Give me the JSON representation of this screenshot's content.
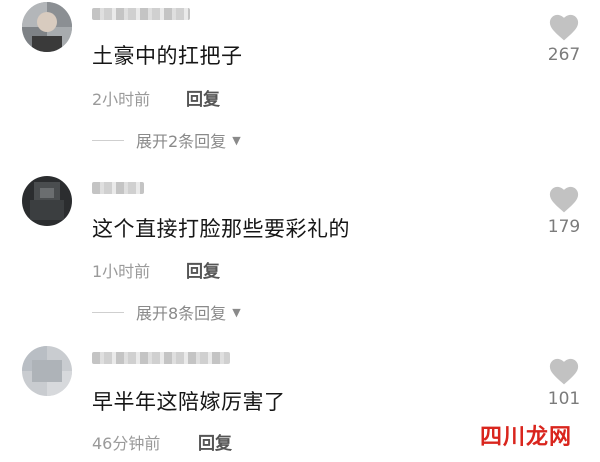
{
  "comments": [
    {
      "content": "土豪中的扛把子",
      "time": "2小时前",
      "reply_label": "回复",
      "likes": "267",
      "expand_label": "展开2条回复"
    },
    {
      "content": "这个直接打脸那些要彩礼的",
      "time": "1小时前",
      "reply_label": "回复",
      "likes": "179",
      "expand_label": "展开8条回复"
    },
    {
      "content": "早半年这陪嫁厉害了",
      "time": "46分钟前",
      "reply_label": "回复",
      "likes": "101"
    }
  ],
  "watermark": {
    "part1": "四川",
    "part2": "龙网"
  },
  "colors": {
    "like_heart": "#c2c2c2",
    "meta_text": "#9a9a9a",
    "watermark_red": "#d9251d"
  },
  "icons": {
    "like": "heart-icon",
    "expand": "caret-down-icon"
  }
}
